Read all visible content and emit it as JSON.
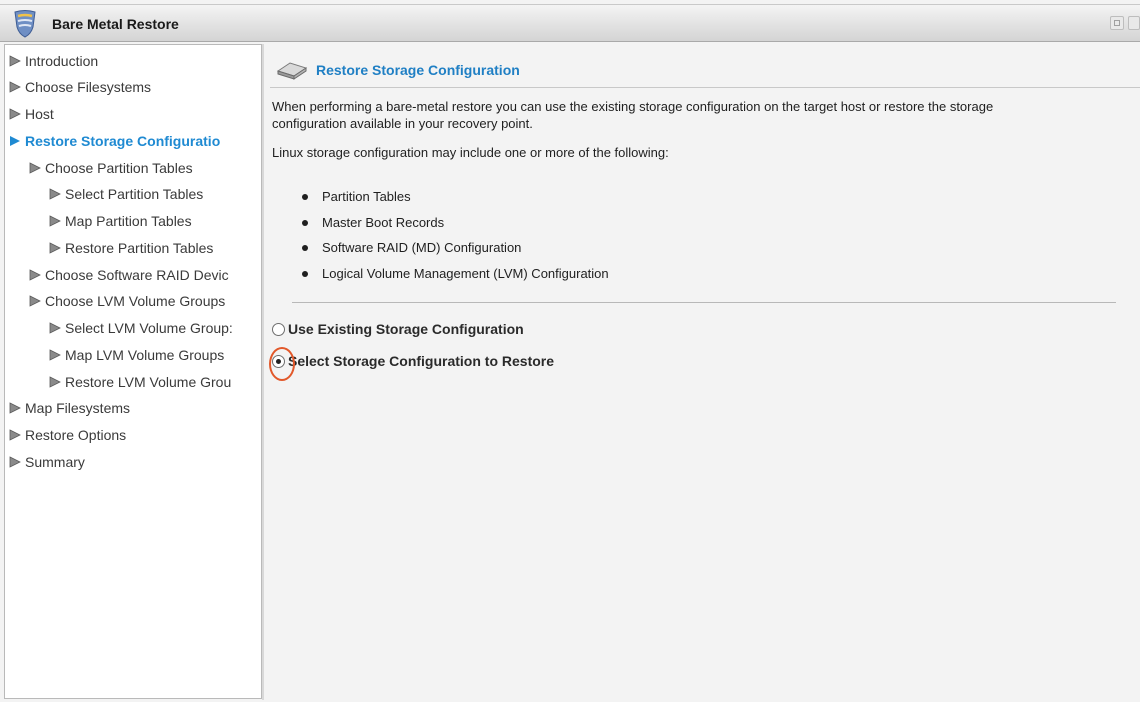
{
  "window": {
    "title": "Bare Metal Restore",
    "icon": "shield-icon"
  },
  "sidebar": {
    "items": [
      {
        "label": "Introduction",
        "level": 0,
        "active": false
      },
      {
        "label": "Choose Filesystems",
        "level": 0,
        "active": false
      },
      {
        "label": "Host",
        "level": 0,
        "active": false
      },
      {
        "label": "Restore Storage Configuratio",
        "level": 0,
        "active": true
      },
      {
        "label": "Choose Partition Tables",
        "level": 1,
        "active": false
      },
      {
        "label": "Select Partition Tables",
        "level": 2,
        "active": false
      },
      {
        "label": "Map Partition Tables",
        "level": 2,
        "active": false
      },
      {
        "label": "Restore Partition Tables",
        "level": 2,
        "active": false
      },
      {
        "label": "Choose Software RAID Devic",
        "level": 1,
        "active": false
      },
      {
        "label": "Choose LVM Volume Groups",
        "level": 1,
        "active": false
      },
      {
        "label": "Select LVM Volume Group:",
        "level": 2,
        "active": false
      },
      {
        "label": "Map LVM Volume Groups",
        "level": 2,
        "active": false
      },
      {
        "label": "Restore LVM Volume Grou",
        "level": 2,
        "active": false
      },
      {
        "label": "Map Filesystems",
        "level": 0,
        "active": false
      },
      {
        "label": "Restore Options",
        "level": 0,
        "active": false
      },
      {
        "label": "Summary",
        "level": 0,
        "active": false
      }
    ]
  },
  "main": {
    "header_title": "Restore Storage Configuration",
    "header_icon": "storage-disk-icon",
    "intro_line1": "When performing a bare-metal restore you can use the existing storage configuration on the target host or restore the storage",
    "intro_line2": "configuration available in your recovery point.",
    "linux_note": "Linux storage configuration may include one or more of the following:",
    "bullets": [
      "Partition Tables",
      "Master Boot Records",
      "Software RAID (MD) Configuration",
      "Logical Volume Management (LVM) Configuration"
    ],
    "options": [
      {
        "label": "Use Existing Storage Configuration",
        "checked": false
      },
      {
        "label": "Select Storage Configuration to Restore",
        "checked": true
      }
    ]
  },
  "colors": {
    "accent": "#1f7fc4",
    "highlight_ring": "#e2582a"
  }
}
